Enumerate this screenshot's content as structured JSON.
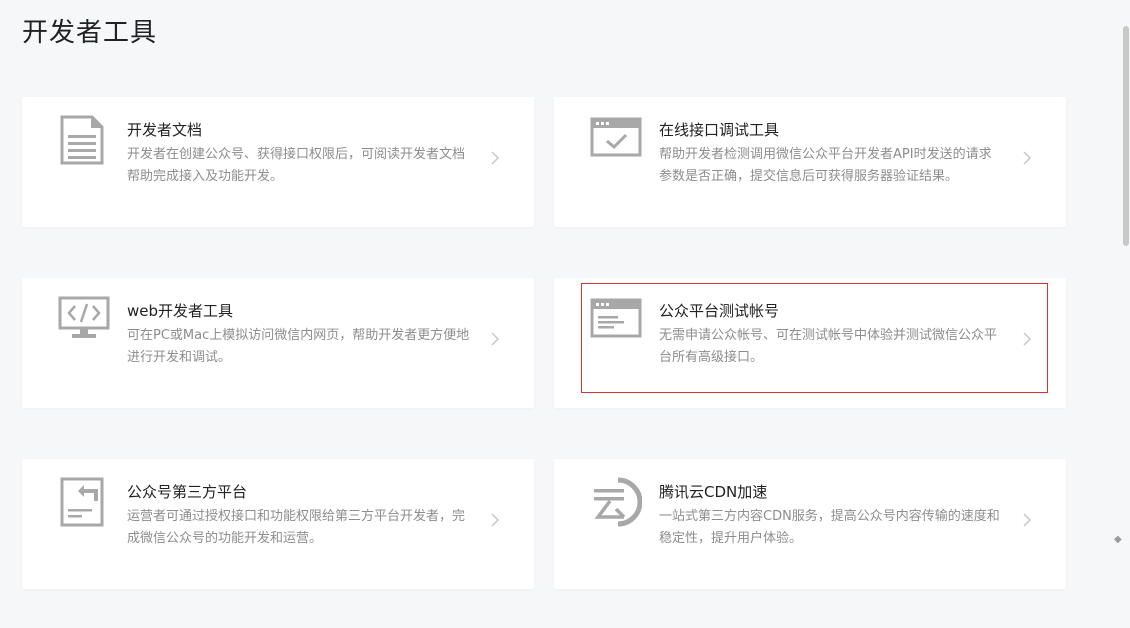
{
  "page": {
    "title": "开发者工具"
  },
  "cards": [
    {
      "title": "开发者文档",
      "desc": "开发者在创建公众号、获得接口权限后，可阅读开发者文档帮助完成接入及功能开发。",
      "icon": "document-icon"
    },
    {
      "title": "在线接口调试工具",
      "desc": "帮助开发者检测调用微信公众平台开发者API时发送的请求参数是否正确，提交信息后可获得服务器验证结果。",
      "icon": "browser-check-icon"
    },
    {
      "title": "web开发者工具",
      "desc": "可在PC或Mac上模拟访问微信内网页，帮助开发者更方便地进行开发和调试。",
      "icon": "monitor-code-icon"
    },
    {
      "title": "公众平台测试帐号",
      "desc": "无需申请公众帐号、可在测试帐号中体验并测试微信公众平台所有高级接口。",
      "icon": "browser-window-icon"
    },
    {
      "title": "公众号第三方平台",
      "desc": "运营者可通过授权接口和功能权限给第三方平台开发者，完成微信公众号的功能开发和运营。",
      "icon": "document-share-icon"
    },
    {
      "title": "腾讯云CDN加速",
      "desc": "一站式第三方内容CDN服务，提高公众号内容传输的速度和稳定性，提升用户体验。",
      "icon": "cloud-logo-icon"
    }
  ],
  "colors": {
    "background": "#f6f7f9",
    "icon": "#a8a8a8",
    "highlight": "#d9322f",
    "text": "#222222",
    "desc": "#8d8d8d"
  }
}
